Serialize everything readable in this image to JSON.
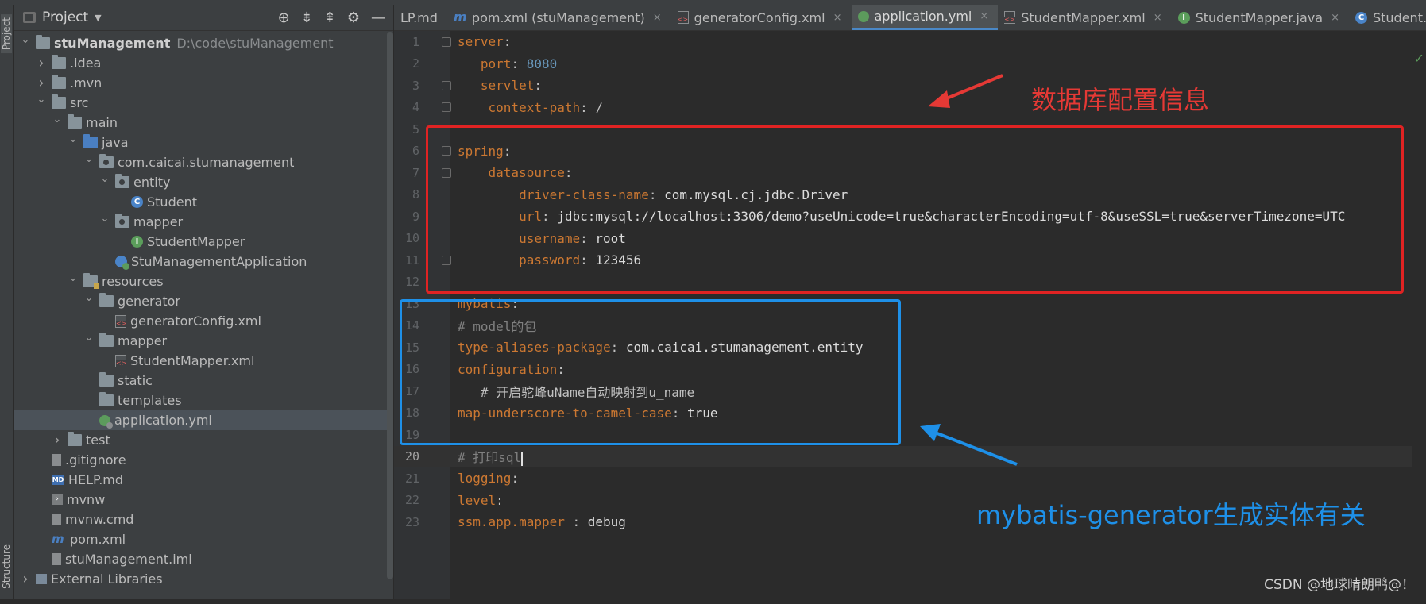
{
  "project_panel": {
    "title": "Project",
    "side_tabs": {
      "project": "Project",
      "structure": "Structure"
    },
    "tree": [
      {
        "label": "stuManagement",
        "extra": "D:\\code\\stuManagement",
        "depth": 0,
        "arrow": "down",
        "icon": "folder"
      },
      {
        "label": ".idea",
        "depth": 1,
        "arrow": "right",
        "icon": "folder"
      },
      {
        "label": ".mvn",
        "depth": 1,
        "arrow": "right",
        "icon": "folder"
      },
      {
        "label": "src",
        "depth": 1,
        "arrow": "down",
        "icon": "folder"
      },
      {
        "label": "main",
        "depth": 2,
        "arrow": "down",
        "icon": "folder"
      },
      {
        "label": "java",
        "depth": 3,
        "arrow": "down",
        "icon": "folder-blue"
      },
      {
        "label": "com.caicai.stumanagement",
        "depth": 4,
        "arrow": "down",
        "icon": "package"
      },
      {
        "label": "entity",
        "depth": 5,
        "arrow": "down",
        "icon": "package"
      },
      {
        "label": "Student",
        "depth": 6,
        "arrow": "none",
        "icon": "class"
      },
      {
        "label": "mapper",
        "depth": 5,
        "arrow": "down",
        "icon": "package"
      },
      {
        "label": "StudentMapper",
        "depth": 6,
        "arrow": "none",
        "icon": "interface"
      },
      {
        "label": "StuManagementApplication",
        "depth": 5,
        "arrow": "none",
        "icon": "app"
      },
      {
        "label": "resources",
        "depth": 3,
        "arrow": "down",
        "icon": "folder-res"
      },
      {
        "label": "generator",
        "depth": 4,
        "arrow": "down",
        "icon": "folder"
      },
      {
        "label": "generatorConfig.xml",
        "depth": 5,
        "arrow": "none",
        "icon": "xml"
      },
      {
        "label": "mapper",
        "depth": 4,
        "arrow": "down",
        "icon": "folder"
      },
      {
        "label": "StudentMapper.xml",
        "depth": 5,
        "arrow": "none",
        "icon": "xml"
      },
      {
        "label": "static",
        "depth": 4,
        "arrow": "none",
        "icon": "folder"
      },
      {
        "label": "templates",
        "depth": 4,
        "arrow": "none",
        "icon": "folder"
      },
      {
        "label": "application.yml",
        "depth": 4,
        "arrow": "none",
        "icon": "yml",
        "selected": true
      },
      {
        "label": "test",
        "depth": 2,
        "arrow": "right",
        "icon": "folder"
      },
      {
        "label": ".gitignore",
        "depth": 1,
        "arrow": "none",
        "icon": "file"
      },
      {
        "label": "HELP.md",
        "depth": 1,
        "arrow": "none",
        "icon": "md"
      },
      {
        "label": "mvnw",
        "depth": 1,
        "arrow": "none",
        "icon": "term"
      },
      {
        "label": "mvnw.cmd",
        "depth": 1,
        "arrow": "none",
        "icon": "file"
      },
      {
        "label": "pom.xml",
        "depth": 1,
        "arrow": "none",
        "icon": "mvn"
      },
      {
        "label": "stuManagement.iml",
        "depth": 1,
        "arrow": "none",
        "icon": "file"
      },
      {
        "label": "External Libraries",
        "depth": 0,
        "arrow": "right",
        "icon": "lib"
      }
    ]
  },
  "tabs": [
    {
      "label": "LP.md",
      "icon": "none",
      "active": false
    },
    {
      "label": "pom.xml (stuManagement)",
      "icon": "m",
      "active": false
    },
    {
      "label": "generatorConfig.xml",
      "icon": "x",
      "active": false
    },
    {
      "label": "application.yml",
      "icon": "y",
      "active": true
    },
    {
      "label": "StudentMapper.xml",
      "icon": "x",
      "active": false
    },
    {
      "label": "StudentMapper.java",
      "icon": "i",
      "active": false
    },
    {
      "label": "Student.java",
      "icon": "c",
      "active": false
    }
  ],
  "close_glyph": "×",
  "code_lines": [
    {
      "n": "1",
      "parts": [
        [
          "k",
          "server"
        ],
        [
          "w",
          ":"
        ]
      ],
      "fold": true
    },
    {
      "n": "2",
      "parts": [
        [
          "w",
          "   "
        ],
        [
          "k",
          "port"
        ],
        [
          "w",
          ": "
        ],
        [
          "n",
          "8080"
        ]
      ]
    },
    {
      "n": "3",
      "parts": [
        [
          "w",
          "   "
        ],
        [
          "k",
          "servlet"
        ],
        [
          "w",
          ":"
        ]
      ],
      "fold": true
    },
    {
      "n": "4",
      "parts": [
        [
          "w",
          "    "
        ],
        [
          "k",
          "context-path"
        ],
        [
          "w",
          ": /"
        ]
      ],
      "fold": true
    },
    {
      "n": "5",
      "parts": []
    },
    {
      "n": "6",
      "parts": [
        [
          "k",
          "spring"
        ],
        [
          "w",
          ":"
        ]
      ],
      "fold": true
    },
    {
      "n": "7",
      "parts": [
        [
          "w",
          "    "
        ],
        [
          "k",
          "datasource"
        ],
        [
          "w",
          ":"
        ]
      ],
      "fold": true
    },
    {
      "n": "8",
      "parts": [
        [
          "w",
          "        "
        ],
        [
          "k",
          "driver-class-name"
        ],
        [
          "w",
          ": "
        ],
        [
          "s",
          "com.mysql.cj.jdbc.Driver"
        ]
      ]
    },
    {
      "n": "9",
      "parts": [
        [
          "w",
          "        "
        ],
        [
          "k",
          "url"
        ],
        [
          "w",
          ": "
        ],
        [
          "s",
          "jdbc:mysql://localhost:3306/demo?useUnicode=true&characterEncoding=utf-8&useSSL=true&serverTimezone=UTC"
        ]
      ]
    },
    {
      "n": "10",
      "parts": [
        [
          "w",
          "        "
        ],
        [
          "k",
          "username"
        ],
        [
          "w",
          ": "
        ],
        [
          "s",
          "root"
        ]
      ]
    },
    {
      "n": "11",
      "parts": [
        [
          "w",
          "        "
        ],
        [
          "k",
          "password"
        ],
        [
          "w",
          ": "
        ],
        [
          "s",
          "123456"
        ]
      ],
      "fold": true
    },
    {
      "n": "12",
      "parts": []
    },
    {
      "n": "13",
      "parts": [
        [
          "k",
          "mybatis"
        ],
        [
          "w",
          ":"
        ]
      ]
    },
    {
      "n": "14",
      "parts": [
        [
          "c",
          "# model的包"
        ]
      ]
    },
    {
      "n": "15",
      "parts": [
        [
          "k",
          "type-aliases-package"
        ],
        [
          "w",
          ": "
        ],
        [
          "s",
          "com.caicai.stumanagement.entity"
        ]
      ]
    },
    {
      "n": "16",
      "parts": [
        [
          "k",
          "configuration"
        ],
        [
          "w",
          ":"
        ]
      ]
    },
    {
      "n": "17",
      "parts": [
        [
          "w",
          "   # 开启驼峰uName自动映射到u_name"
        ]
      ]
    },
    {
      "n": "18",
      "parts": [
        [
          "k",
          "map-underscore-to-camel-case"
        ],
        [
          "w",
          ": "
        ],
        [
          "s",
          "true"
        ]
      ]
    },
    {
      "n": "19",
      "parts": []
    },
    {
      "n": "20",
      "parts": [
        [
          "c",
          "# 打印sql"
        ]
      ],
      "current": true
    },
    {
      "n": "21",
      "parts": [
        [
          "k",
          "logging"
        ],
        [
          "w",
          ":"
        ]
      ]
    },
    {
      "n": "22",
      "parts": [
        [
          "k",
          "level"
        ],
        [
          "w",
          ":"
        ]
      ]
    },
    {
      "n": "23",
      "parts": [
        [
          "k",
          "ssm.app.mapper"
        ],
        [
          "w",
          " : "
        ],
        [
          "s",
          "debug"
        ]
      ]
    }
  ],
  "annotations": {
    "red_label": "数据库配置信息",
    "blue_label": "mybatis-generator生成实体有关"
  },
  "watermark": "CSDN @地球晴朗鸭@！",
  "colors": {
    "red_box": "#e02323",
    "blue_box": "#1e90e8",
    "keyword": "#cc7832",
    "number": "#6897bb"
  }
}
